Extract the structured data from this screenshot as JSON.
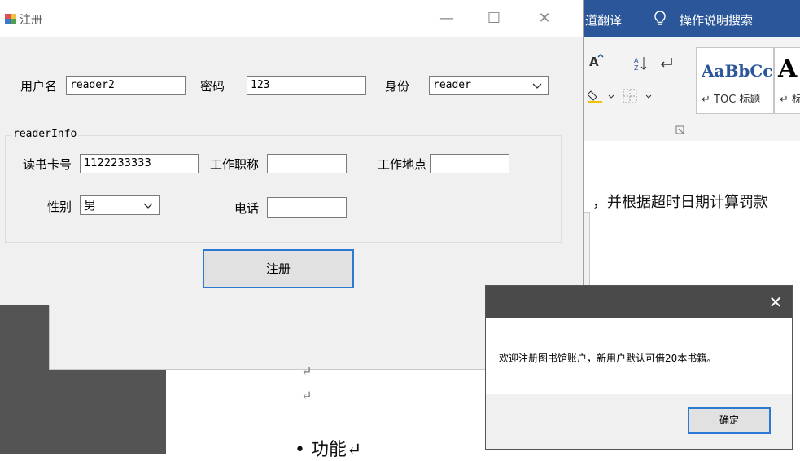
{
  "background_app": {
    "ribbon_tabs": [
      "有道翻译",
      "操作说明搜索"
    ],
    "ribbon_icons": [
      "lightbulb-icon",
      "text-highlight-icon",
      "sort-icon",
      "paragraph-mark-icon",
      "shading-icon",
      "borders-icon"
    ],
    "styles": [
      {
        "preview": "AaBbCc",
        "name": "↵ TOC 标题"
      },
      {
        "preview": "A",
        "name": "↵ 标"
      }
    ],
    "doc_lines": [
      "，并根据超时日期计算罚款",
      "↵",
      "↵",
      "• 功能↵"
    ]
  },
  "register_window": {
    "title": "注册",
    "controls": {
      "minimize": "—",
      "maximize": "☐",
      "close": "✕"
    },
    "fields": {
      "username_label": "用户名",
      "username_value": "reader2",
      "password_label": "密码",
      "password_value": "123",
      "identity_label": "身份",
      "identity_value": "reader"
    },
    "group": {
      "title": "readerInfo",
      "card_label": "读书卡号",
      "card_value": "1122233333",
      "job_title_label": "工作职称",
      "job_title_value": "",
      "work_place_label": "工作地点",
      "work_place_value": "",
      "gender_label": "性别",
      "gender_value": "男",
      "phone_label": "电话",
      "phone_value": ""
    },
    "register_button": "注册"
  },
  "message_box": {
    "close": "✕",
    "message": "欢迎注册图书馆账户，新用户默认可借20本书籍。",
    "ok_button": "确定"
  }
}
